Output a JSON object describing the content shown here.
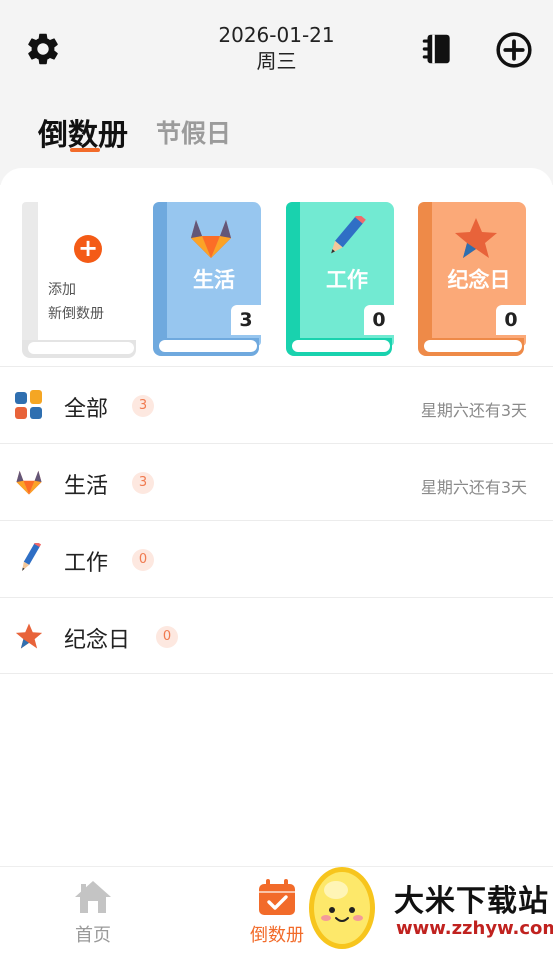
{
  "header": {
    "date": "2026-01-21",
    "weekday": "周三",
    "icons": [
      "gear-icon",
      "notebook-icon",
      "add-circle-icon"
    ]
  },
  "tabs": [
    {
      "label": "倒数册",
      "active": true
    },
    {
      "label": "节假日",
      "active": false
    }
  ],
  "add_book": {
    "line1": "添加",
    "line2": "新倒数册"
  },
  "books": [
    {
      "title": "生活",
      "count": "3",
      "color": "#92c4ef",
      "icon": "gitlab-fox-icon"
    },
    {
      "title": "工作",
      "count": "0",
      "color": "#6ee6cf",
      "icon": "pencil-icon"
    },
    {
      "title": "纪念日",
      "count": "0",
      "color": "#f7a872",
      "icon": "star-icon"
    }
  ],
  "categories": [
    {
      "name": "全部",
      "count": "3",
      "hint": "星期六还有3天",
      "icon": "grid-icon"
    },
    {
      "name": "生活",
      "count": "3",
      "hint": "星期六还有3天",
      "icon": "gitlab-fox-icon"
    },
    {
      "name": "工作",
      "count": "0",
      "hint": "",
      "icon": "pencil-icon"
    },
    {
      "name": "纪念日",
      "count": "0",
      "hint": "",
      "icon": "star-icon"
    }
  ],
  "nav": [
    {
      "label": "首页",
      "active": false
    },
    {
      "label": "倒数册",
      "active": true
    }
  ],
  "watermark": {
    "title": "大米下载站",
    "url": "www.zzhyw.com"
  },
  "colors": {
    "accent": "#f26b2a",
    "badge_bg": "#fde8e0",
    "badge_text": "#f07a4f"
  }
}
